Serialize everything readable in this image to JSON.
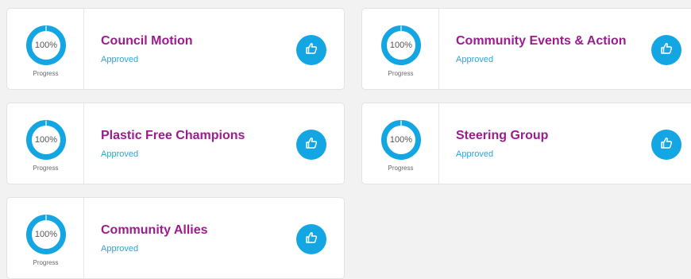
{
  "accent_color": "#13a6e3",
  "title_color": "#9b1c8e",
  "status_color": "#2aa6d9",
  "cards": [
    {
      "title": "Council Motion",
      "status": "Approved",
      "progress_text": "100%",
      "progress_label": "Progress",
      "progress": 1.0,
      "action_icon": "thumbs-up-icon"
    },
    {
      "title": "Community Events & Action",
      "status": "Approved",
      "progress_text": "100%",
      "progress_label": "Progress",
      "progress": 1.0,
      "action_icon": "thumbs-up-icon"
    },
    {
      "title": "Plastic Free Champions",
      "status": "Approved",
      "progress_text": "100%",
      "progress_label": "Progress",
      "progress": 1.0,
      "action_icon": "thumbs-up-icon"
    },
    {
      "title": "Steering Group",
      "status": "Approved",
      "progress_text": "100%",
      "progress_label": "Progress",
      "progress": 1.0,
      "action_icon": "thumbs-up-icon"
    },
    {
      "title": "Community Allies",
      "status": "Approved",
      "progress_text": "100%",
      "progress_label": "Progress",
      "progress": 1.0,
      "action_icon": "thumbs-up-icon"
    }
  ]
}
